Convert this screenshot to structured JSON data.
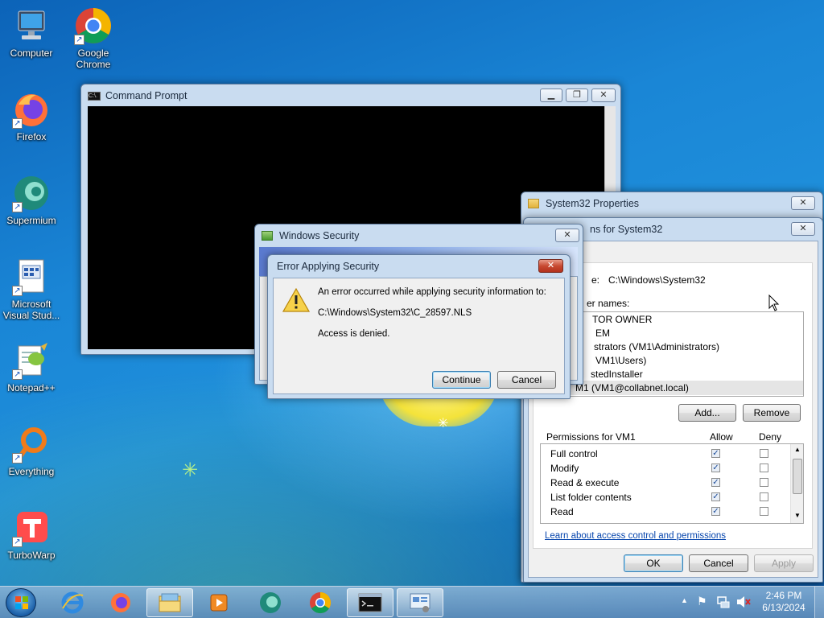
{
  "desktop": {
    "icons": [
      {
        "label": "Computer",
        "icon": "computer-icon"
      },
      {
        "label": "Google Chrome",
        "icon": "chrome-icon"
      },
      {
        "label": "Firefox",
        "icon": "firefox-icon"
      },
      {
        "label": "Supermium",
        "icon": "supermium-icon"
      },
      {
        "label": "Microsoft Visual Stud...",
        "icon": "visual-studio-icon"
      },
      {
        "label": "Notepad++",
        "icon": "notepadpp-icon"
      },
      {
        "label": "Everything",
        "icon": "everything-icon"
      },
      {
        "label": "TurboWarp",
        "icon": "turbowarp-icon"
      }
    ]
  },
  "cmd": {
    "title": "Command Prompt",
    "icon_text": "C:\\."
  },
  "props": {
    "title": "System32 Properties",
    "close": "✕"
  },
  "perm": {
    "title_fragment": "ns for System32",
    "object_label_fragment": "e:",
    "object_path": "C:\\Windows\\System32",
    "group_label_fragment": "er names:",
    "groups": [
      "TOR OWNER",
      "EM",
      "strators (VM1\\Administrators)",
      "VM1\\Users)",
      "stedInstaller",
      "M1 (VM1@collabnet.local)"
    ],
    "add_label": "Add...",
    "remove_label": "Remove",
    "permissions_for": "Permissions for VM1",
    "allow_label": "Allow",
    "deny_label": "Deny",
    "rows": [
      {
        "name": "Full control",
        "allow": true,
        "deny": false
      },
      {
        "name": "Modify",
        "allow": true,
        "deny": false
      },
      {
        "name": "Read & execute",
        "allow": true,
        "deny": false
      },
      {
        "name": "List folder contents",
        "allow": true,
        "deny": false
      },
      {
        "name": "Read",
        "allow": true,
        "deny": false
      }
    ],
    "learn_link": "Learn about access control and permissions",
    "ok_label": "OK",
    "cancel_label": "Cancel",
    "apply_label": "Apply"
  },
  "winsec": {
    "title": "Windows Security"
  },
  "error": {
    "title": "Error Applying Security",
    "line1": "An error occurred while applying security information to:",
    "path": "C:\\Windows\\System32\\C_28597.NLS",
    "line3": "Access is denied.",
    "continue_label": "Continue",
    "cancel_label": "Cancel"
  },
  "taskbar": {
    "time": "2:46 PM",
    "date": "6/13/2024",
    "items": [
      "ie-icon",
      "firefox-icon",
      "explorer-icon",
      "media-player-icon",
      "supermium-icon",
      "chrome-icon",
      "cmd-icon",
      "security-icon"
    ]
  }
}
